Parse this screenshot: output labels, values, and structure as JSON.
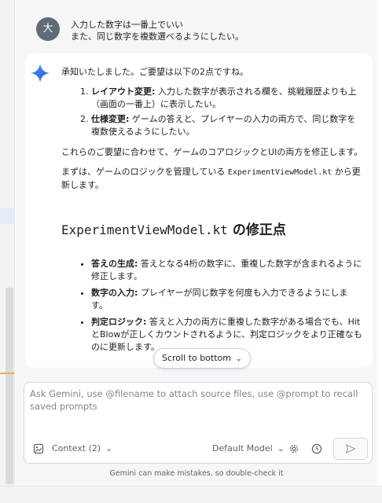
{
  "user_message": {
    "avatar": "大",
    "lines": [
      "入力した数字は一番上でいい",
      "また、同じ数字を複数選べるようにしたい。"
    ]
  },
  "assistant_message": {
    "intro": "承知いたしました。ご要望は以下の2点ですね。",
    "requests": [
      {
        "title": "レイアウト変更:",
        "text": " 入力した数字が表示される欄を、挑戦履歴よりも上（画面の一番上）に表示したい。"
      },
      {
        "title": "仕様変更:",
        "text": " ゲームの答えと、プレイヤーの入力の両方で、同じ数字を複数使えるようにしたい。"
      }
    ],
    "para1": "これらのご要望に合わせて、ゲームのコアロジックとUIの両方を修正します。",
    "para2_pre": "まずは、ゲームのロジックを管理している ",
    "para2_code": "ExperimentViewModel.kt",
    "para2_post": " から更新します。",
    "heading_code": "ExperimentViewModel.kt",
    "heading_text": " の修正点",
    "bullets": [
      {
        "title": "答えの生成:",
        "text": " 答えとなる4桁の数字に、重複した数字が含まれるように修正します。"
      },
      {
        "title": "数字の入力:",
        "text": " プレイヤーが同じ数字を何度も入力できるようにします。"
      },
      {
        "title": "判定ロジック:",
        "text": " 答えと入力の両方に重複した数字がある場合でも、HitとBlowが正しくカウントされるように、判定ロジックをより正確なものに更新します。"
      }
    ]
  },
  "scroll_chip": {
    "label": "Scroll to bottom"
  },
  "input": {
    "placeholder": "Ask Gemini, use @filename to attach source files, use @prompt to recall saved prompts"
  },
  "toolbar": {
    "context_label": "Context (2)",
    "model_label": "Default Model"
  },
  "footer": {
    "disclaimer": "Gemini can make mistakes, so double-check it"
  },
  "colors": {
    "accent": "#3b6fe0",
    "panel_bg": "#f5f6f8",
    "avatar_bg": "#5f6b78"
  }
}
